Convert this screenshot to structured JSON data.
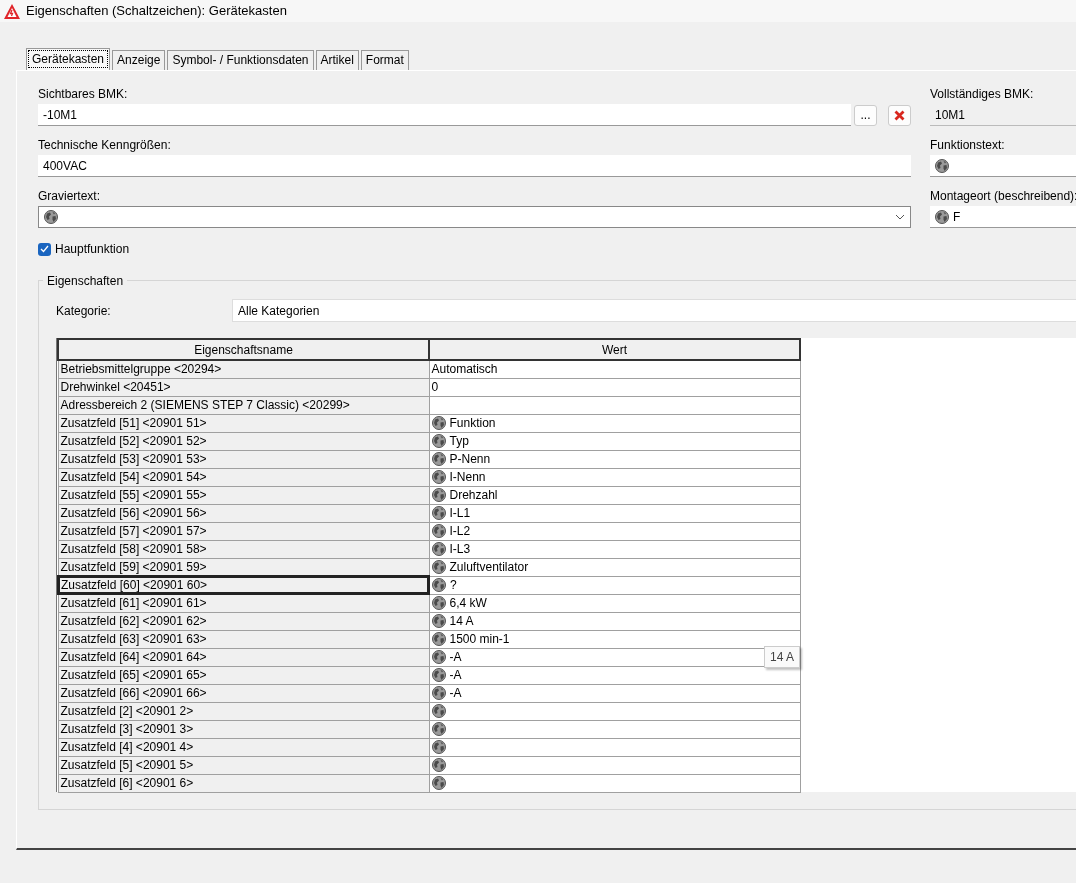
{
  "window": {
    "title": "Eigenschaften (Schaltzeichen): Gerätekasten"
  },
  "tabs": [
    {
      "label": "Gerätekasten",
      "selected": true
    },
    {
      "label": "Anzeige",
      "selected": false
    },
    {
      "label": "Symbol- / Funktionsdaten",
      "selected": false
    },
    {
      "label": "Artikel",
      "selected": false
    },
    {
      "label": "Format",
      "selected": false
    }
  ],
  "left_fields": [
    {
      "label": "Sichtbares BMK:",
      "value": "-10M1",
      "kind": "text",
      "buttons": [
        {
          "kind": "more",
          "label": "..."
        },
        {
          "kind": "clear"
        }
      ]
    },
    {
      "label": "Technische Kenngrößen:",
      "value": "400VAC",
      "kind": "text"
    },
    {
      "label": "Graviertext:",
      "kind": "combo",
      "globe": true
    }
  ],
  "right_fields": [
    {
      "label": "Vollständiges BMK:",
      "value": "10M1",
      "kind": "readonly"
    },
    {
      "label": "Funktionstext:",
      "kind": "text",
      "globe": true
    },
    {
      "label": "Montageort (beschreibend):",
      "value": "F",
      "kind": "text",
      "globe": true
    }
  ],
  "checkbox": {
    "label": "Hauptfunktion",
    "checked": true
  },
  "properties": {
    "title": "Eigenschaften",
    "category_label": "Kategorie:",
    "category_value": "Alle Kategorien",
    "columns": [
      "Eigenschaftsname",
      "Wert"
    ],
    "rows": [
      {
        "name": "Betriebsmittelgruppe <20294>",
        "value": "Automatisch",
        "globe": false,
        "selected": false
      },
      {
        "name": "Drehwinkel <20451>",
        "value": "0",
        "globe": false,
        "selected": false
      },
      {
        "name": "Adressbereich 2 (SIEMENS STEP 7 Classic) <20299>",
        "globe": false,
        "selected": false
      },
      {
        "name": "Zusatzfeld [51] <20901 51>",
        "value": "Funktion",
        "globe": true,
        "selected": false
      },
      {
        "name": "Zusatzfeld [52] <20901 52>",
        "value": "Typ",
        "globe": true,
        "selected": false
      },
      {
        "name": "Zusatzfeld [53] <20901 53>",
        "value": "P-Nenn",
        "globe": true,
        "selected": false
      },
      {
        "name": "Zusatzfeld [54] <20901 54>",
        "value": "I-Nenn",
        "globe": true,
        "selected": false
      },
      {
        "name": "Zusatzfeld [55] <20901 55>",
        "value": "Drehzahl",
        "globe": true,
        "selected": false
      },
      {
        "name": "Zusatzfeld [56] <20901 56>",
        "value": "I-L1",
        "globe": true,
        "selected": false
      },
      {
        "name": "Zusatzfeld [57] <20901 57>",
        "value": "I-L2",
        "globe": true,
        "selected": false
      },
      {
        "name": "Zusatzfeld [58] <20901 58>",
        "value": "I-L3",
        "globe": true,
        "selected": false
      },
      {
        "name": "Zusatzfeld [59] <20901 59>",
        "value": "Zuluftventilator",
        "globe": true,
        "selected": false
      },
      {
        "name": "Zusatzfeld [60] <20901 60>",
        "value": "?",
        "globe": true,
        "selected": true
      },
      {
        "name": "Zusatzfeld [61] <20901 61>",
        "value": "6,4 kW",
        "globe": true,
        "selected": false
      },
      {
        "name": "Zusatzfeld [62] <20901 62>",
        "value": "14 A",
        "globe": true,
        "selected": false
      },
      {
        "name": "Zusatzfeld [63] <20901 63>",
        "value": "1500 min-1",
        "globe": true,
        "selected": false
      },
      {
        "name": "Zusatzfeld [64] <20901 64>",
        "value": "-A",
        "globe": true,
        "selected": false
      },
      {
        "name": "Zusatzfeld [65] <20901 65>",
        "value": "-A",
        "globe": true,
        "selected": false
      },
      {
        "name": "Zusatzfeld [66] <20901 66>",
        "value": "-A",
        "globe": true,
        "selected": false
      },
      {
        "name": "Zusatzfeld [2] <20901 2>",
        "globe": true,
        "selected": false
      },
      {
        "name": "Zusatzfeld [3] <20901 3>",
        "globe": true,
        "selected": false
      },
      {
        "name": "Zusatzfeld [4] <20901 4>",
        "globe": true,
        "selected": false
      },
      {
        "name": "Zusatzfeld [5] <20901 5>",
        "globe": true,
        "selected": false
      },
      {
        "name": "Zusatzfeld [6] <20901 6>",
        "globe": true,
        "selected": false
      }
    ]
  },
  "tooltip": {
    "text": "14 A"
  }
}
